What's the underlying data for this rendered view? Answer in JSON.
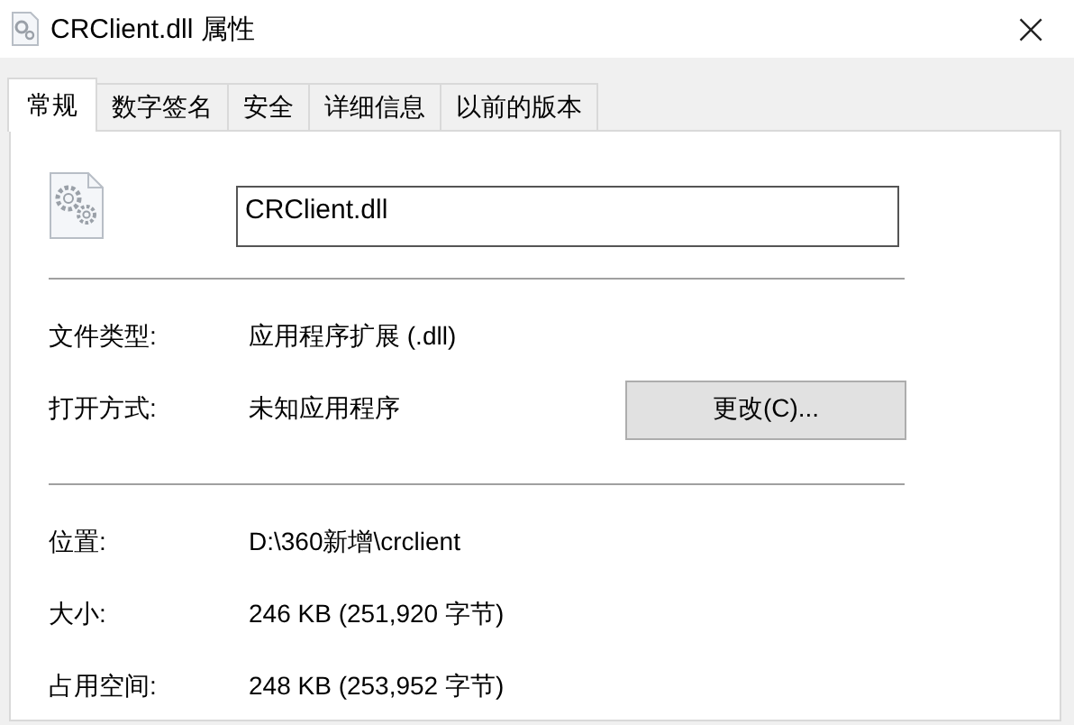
{
  "window": {
    "title": "CRClient.dll 属性",
    "close": "×"
  },
  "tabs": [
    {
      "label": "常规",
      "selected": true
    },
    {
      "label": "数字签名",
      "selected": false
    },
    {
      "label": "安全",
      "selected": false
    },
    {
      "label": "详细信息",
      "selected": false
    },
    {
      "label": "以前的版本",
      "selected": false
    }
  ],
  "file_name": "CRClient.dll",
  "sections": [
    {
      "rows": [
        {
          "label": "文件类型:",
          "value": "应用程序扩展 (.dll)"
        },
        {
          "label": "打开方式:",
          "value": "未知应用程序",
          "button": "更改(C)..."
        }
      ]
    },
    {
      "rows": [
        {
          "label": "位置:",
          "value": "D:\\360新增\\crclient"
        },
        {
          "label": "大小:",
          "value": "246 KB (251,920 字节)"
        },
        {
          "label": "占用空间:",
          "value": "248 KB (253,952 字节)"
        }
      ]
    }
  ]
}
